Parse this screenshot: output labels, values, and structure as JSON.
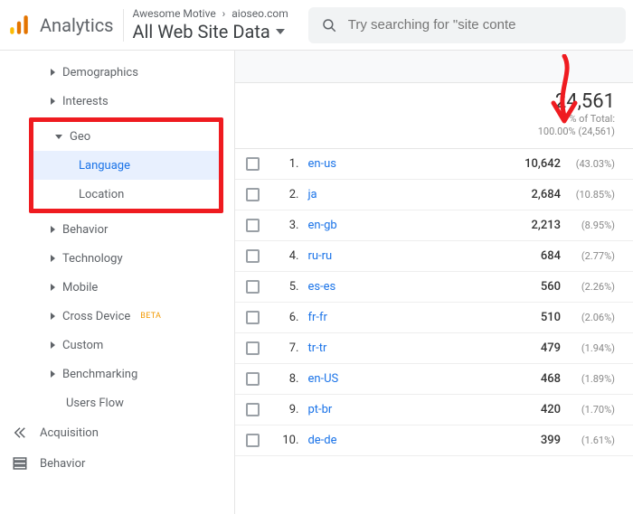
{
  "header": {
    "brand": "Analytics",
    "breadcrumb_parent": "Awesome Motive",
    "breadcrumb_sep": "›",
    "breadcrumb_child": "aioseo.com",
    "view_name": "All Web Site Data",
    "search_placeholder": "Try searching for \"site conte"
  },
  "sidebar": {
    "items": {
      "demographics": "Demographics",
      "interests": "Interests",
      "geo": "Geo",
      "language": "Language",
      "location": "Location",
      "behavior": "Behavior",
      "technology": "Technology",
      "mobile": "Mobile",
      "cross_device": "Cross Device",
      "cross_device_beta": "BETA",
      "custom": "Custom",
      "benchmarking": "Benchmarking",
      "users_flow": "Users Flow",
      "acquisition": "Acquisition",
      "behavior_section": "Behavior"
    }
  },
  "summary": {
    "total": "24,561",
    "pct_label": "% of Total:",
    "pct_value": "100.00% (24,561)"
  },
  "rows": [
    {
      "n": "1",
      "lang": "en-us",
      "val": "10,642",
      "pct": "(43.03%)"
    },
    {
      "n": "2",
      "lang": "ja",
      "val": "2,684",
      "pct": "(10.85%)"
    },
    {
      "n": "3",
      "lang": "en-gb",
      "val": "2,213",
      "pct": "(8.95%)"
    },
    {
      "n": "4",
      "lang": "ru-ru",
      "val": "684",
      "pct": "(2.77%)"
    },
    {
      "n": "5",
      "lang": "es-es",
      "val": "560",
      "pct": "(2.26%)"
    },
    {
      "n": "6",
      "lang": "fr-fr",
      "val": "510",
      "pct": "(2.06%)"
    },
    {
      "n": "7",
      "lang": "tr-tr",
      "val": "479",
      "pct": "(1.94%)"
    },
    {
      "n": "8",
      "lang": "en-US",
      "val": "468",
      "pct": "(1.89%)"
    },
    {
      "n": "9",
      "lang": "pt-br",
      "val": "420",
      "pct": "(1.70%)"
    },
    {
      "n": "10",
      "lang": "de-de",
      "val": "399",
      "pct": "(1.61%)"
    }
  ]
}
